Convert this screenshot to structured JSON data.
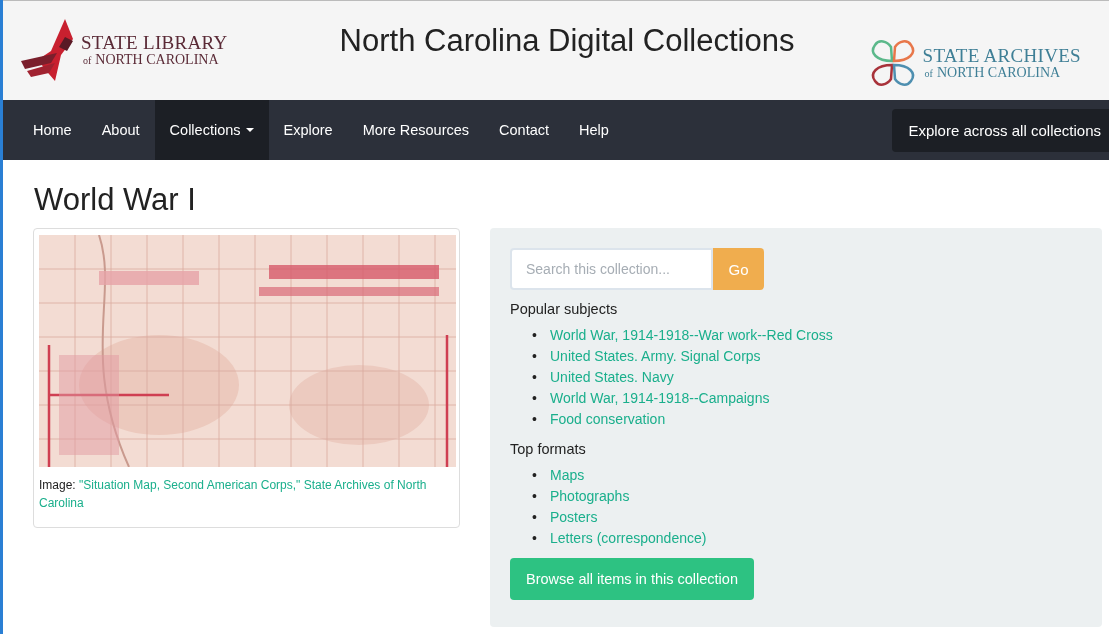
{
  "header": {
    "left_logo": {
      "line1": "STATE LIBRARY",
      "line2_small": "of",
      "line2": "NORTH CAROLINA"
    },
    "title": "North Carolina Digital Collections",
    "right_logo": {
      "line1": "STATE ARCHIVES",
      "line2_small": "of",
      "line2": "NORTH CAROLINA"
    }
  },
  "nav": {
    "items": [
      {
        "label": "Home",
        "selected": false,
        "dropdown": false
      },
      {
        "label": "About",
        "selected": false,
        "dropdown": false
      },
      {
        "label": "Collections",
        "selected": true,
        "dropdown": true
      },
      {
        "label": "Explore",
        "selected": false,
        "dropdown": false
      },
      {
        "label": "More Resources",
        "selected": false,
        "dropdown": false
      },
      {
        "label": "Contact",
        "selected": false,
        "dropdown": false
      },
      {
        "label": "Help",
        "selected": false,
        "dropdown": false
      }
    ],
    "explore_button": "Explore across all collections"
  },
  "page_title": "World War I",
  "feature": {
    "caption_label": "Image:",
    "caption_link_lines": [
      "\"Situation Map, Second American Corps,\" State Archives of North",
      "Carolina"
    ]
  },
  "sidebar": {
    "search": {
      "placeholder": "Search this collection...",
      "button": "Go"
    },
    "sections": [
      {
        "heading": "Popular subjects",
        "bullet": "•",
        "links": [
          "World War, 1914-1918--War work--Red Cross",
          "United States. Army. Signal Corps",
          "United States. Navy",
          "World War, 1914-1918--Campaigns",
          "Food conservation"
        ]
      },
      {
        "heading": "Top formats",
        "bullet": "•",
        "links": [
          "Maps",
          "Photographs",
          "Posters",
          "Letters (correspondence)"
        ]
      }
    ],
    "browse_button": "Browse all items in this collection"
  }
}
